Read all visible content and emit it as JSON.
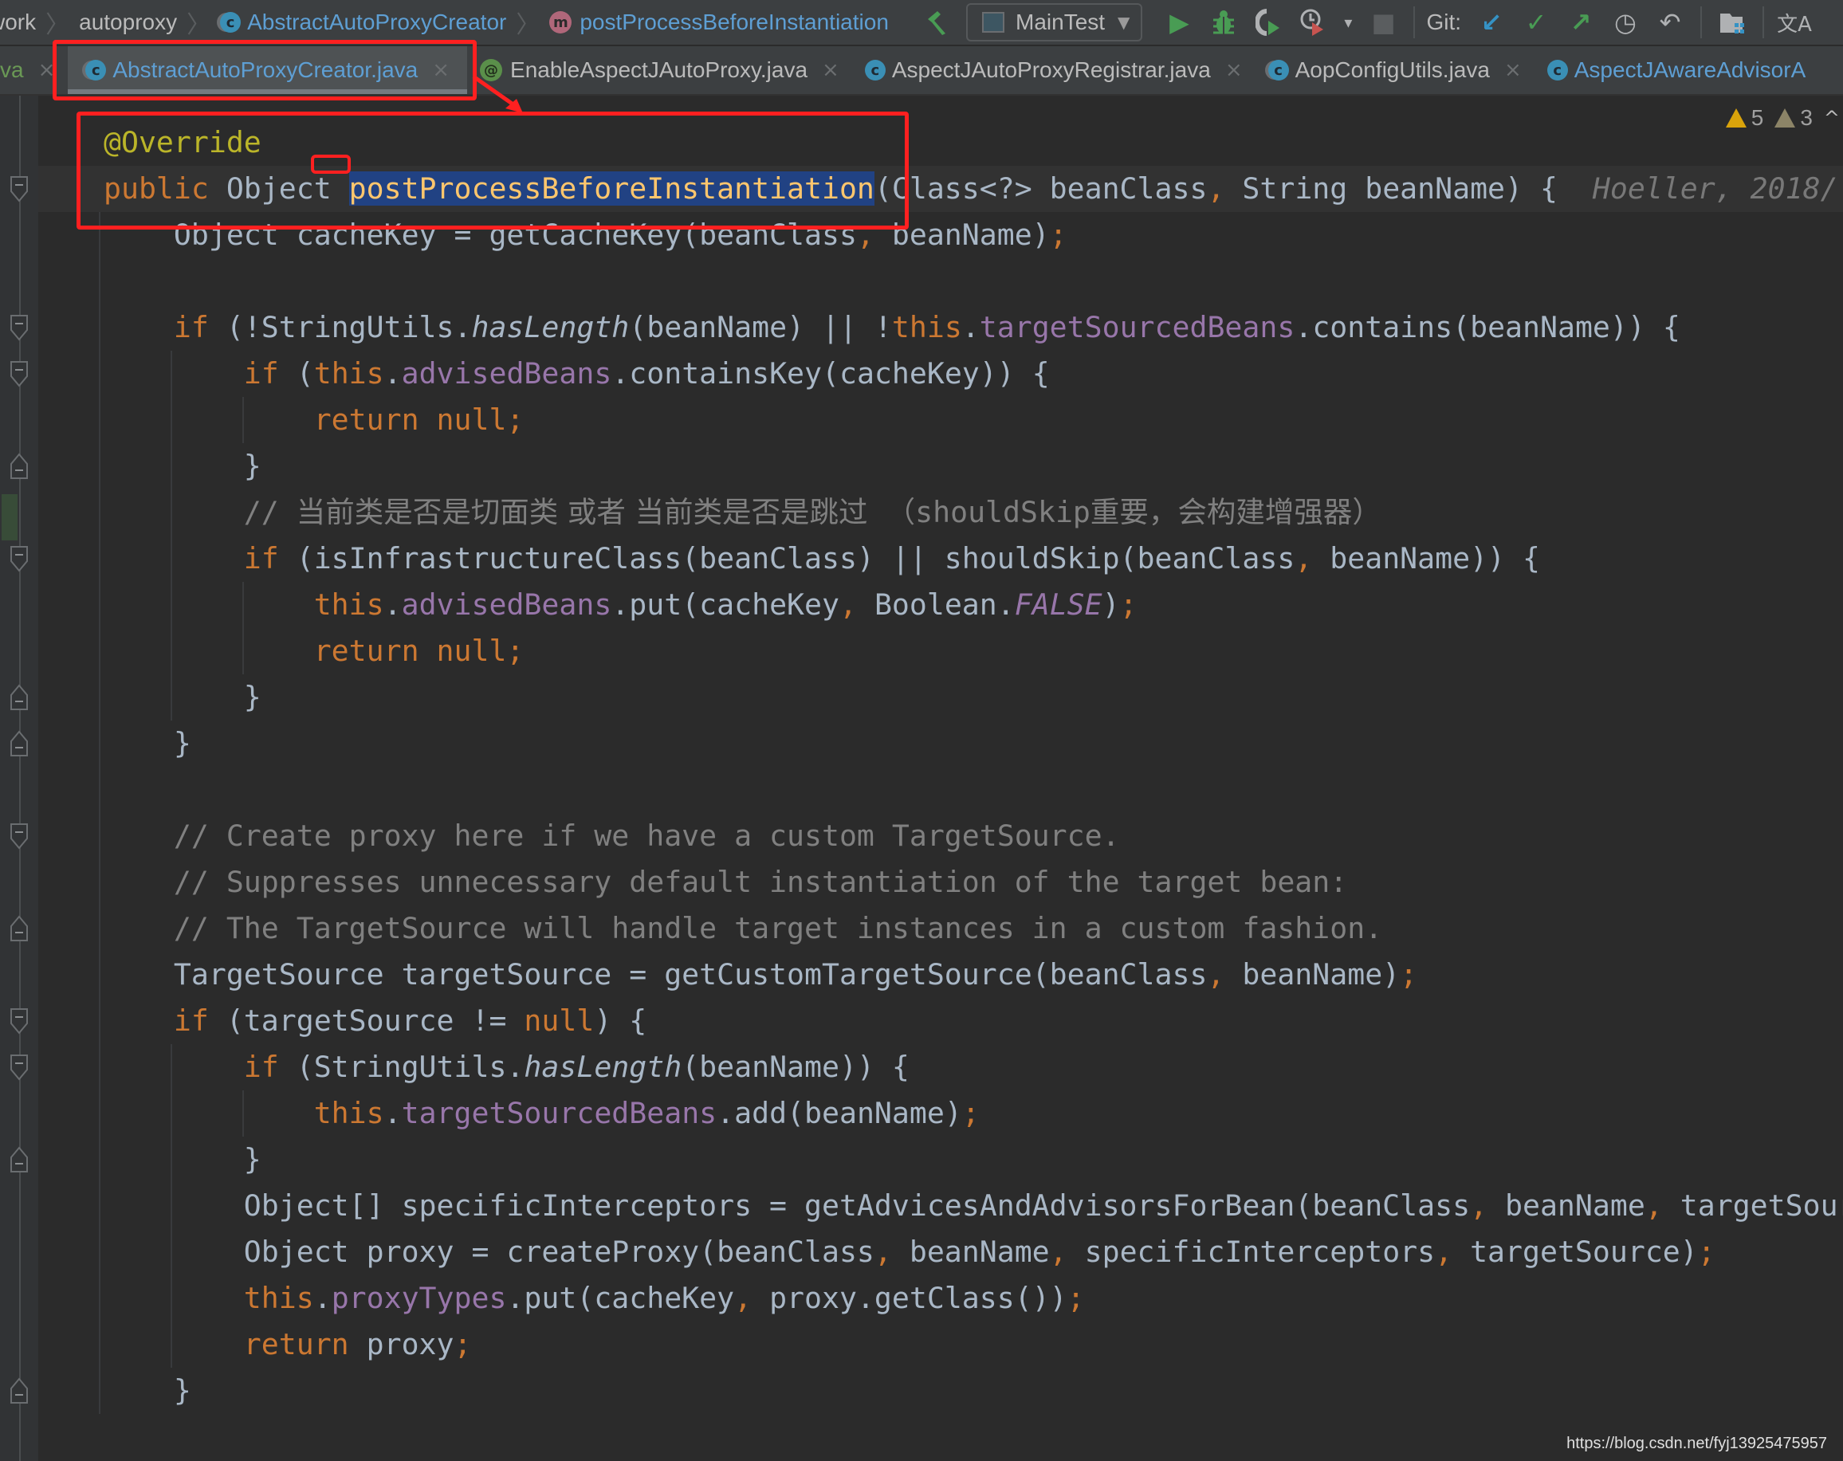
{
  "breadcrumb": {
    "items": [
      {
        "label": "work",
        "icon": null,
        "style": "plain"
      },
      {
        "label": "autoproxy",
        "icon": null,
        "style": "plain"
      },
      {
        "label": "AbstractAutoProxyCreator",
        "icon": "abstract-class-icon",
        "icon_glyph": "c",
        "style": "link"
      },
      {
        "label": "postProcessBeforeInstantiation",
        "icon": "method-icon",
        "icon_glyph": "m",
        "style": "link"
      }
    ],
    "separator": "〉"
  },
  "toolbar": {
    "build_icon": "⬅",
    "run_config": "MainTest",
    "run_config_arrow": "▼",
    "run_icon": "▶",
    "debug_icon": "✱",
    "coverage_icon": "◧",
    "profile_icon": "◔",
    "profile_arrow": "▾",
    "stop_icon": "■",
    "git_label": "Git:",
    "git_update_icon": "↙",
    "git_commit_icon": "✓",
    "git_push_icon": "↗",
    "git_history_icon": "◷",
    "git_rollback_icon": "↶",
    "project_structure_icon": "▙",
    "translate_icon": "文A"
  },
  "tabs": [
    {
      "label": "va",
      "icon": null,
      "active": false,
      "partial": true,
      "close": "×"
    },
    {
      "label": "AbstractAutoProxyCreator.java",
      "icon": "abstract-class-icon",
      "icon_glyph": "c",
      "active": true,
      "close": "×"
    },
    {
      "label": "EnableAspectJAutoProxy.java",
      "icon": "annotation-icon",
      "icon_glyph": "@",
      "active": false,
      "close": "×"
    },
    {
      "label": "AspectJAutoProxyRegistrar.java",
      "icon": "class-icon",
      "icon_glyph": "c",
      "active": false,
      "close": "×"
    },
    {
      "label": "AopConfigUtils.java",
      "icon": "abstract-class-icon",
      "icon_glyph": "c",
      "active": false,
      "close": "×"
    },
    {
      "label": "AspectJAwareAdvisorA",
      "icon": "class-icon",
      "icon_glyph": "c",
      "active": false,
      "close": ""
    }
  ],
  "inspections": {
    "warnings": "5",
    "weak_warnings": "3",
    "nav_up": "^"
  },
  "editor": {
    "blame": "Hoeller, 2018/",
    "lines": [
      [
        [
          "ann",
          "@Override"
        ]
      ],
      [
        [
          "kw",
          "public "
        ],
        [
          "",
          "Object "
        ],
        [
          "fn sel",
          "postProcessBeforeInstantiation"
        ],
        [
          "",
          "(Class<?> beanClass"
        ],
        [
          "punc",
          ", "
        ],
        [
          "",
          "String beanName) {"
        ]
      ],
      [
        [
          "",
          "    Object cacheKey = getCacheKey(beanClass"
        ],
        [
          "punc",
          ", "
        ],
        [
          "",
          "beanName)"
        ],
        [
          "punc",
          ";"
        ]
      ],
      [
        [
          "",
          ""
        ]
      ],
      [
        [
          "kw",
          "    if "
        ],
        [
          "",
          "(!StringUtils."
        ],
        [
          "it",
          "hasLength"
        ],
        [
          "",
          "(beanName) || !"
        ],
        [
          "kw",
          "this"
        ],
        [
          "",
          "."
        ],
        [
          "fld",
          "targetSourcedBeans"
        ],
        [
          "",
          ".contains(beanName)) {"
        ]
      ],
      [
        [
          "kw",
          "        if "
        ],
        [
          "",
          "("
        ],
        [
          "kw",
          "this"
        ],
        [
          "",
          "."
        ],
        [
          "fld",
          "advisedBeans"
        ],
        [
          "",
          ".containsKey(cacheKey)) {"
        ]
      ],
      [
        [
          "kw",
          "            return null;"
        ]
      ],
      [
        [
          "",
          "        }"
        ]
      ],
      [
        [
          "cm",
          "        // "
        ],
        [
          "cmcn",
          "当前类是否是切面类 或者 当前类是否是跳过  （"
        ],
        [
          "cm",
          "shouldSkip"
        ],
        [
          "cmcn",
          "重要，会构建增强器）"
        ]
      ],
      [
        [
          "kw",
          "        if "
        ],
        [
          "",
          "(isInfrastructureClass(beanClass) || shouldSkip(beanClass"
        ],
        [
          "punc",
          ", "
        ],
        [
          "",
          "beanName)) {"
        ]
      ],
      [
        [
          "kw",
          "            this"
        ],
        [
          "",
          "."
        ],
        [
          "fld",
          "advisedBeans"
        ],
        [
          "",
          ".put(cacheKey"
        ],
        [
          "punc",
          ", "
        ],
        [
          "",
          "Boolean."
        ],
        [
          "fld it",
          "FALSE"
        ],
        [
          "",
          ")"
        ],
        [
          "punc",
          ";"
        ]
      ],
      [
        [
          "kw",
          "            return null;"
        ]
      ],
      [
        [
          "",
          "        }"
        ]
      ],
      [
        [
          "",
          "    }"
        ]
      ],
      [
        [
          "",
          ""
        ]
      ],
      [
        [
          "cm",
          "    // Create proxy here if we have a custom TargetSource."
        ]
      ],
      [
        [
          "cm",
          "    // Suppresses unnecessary default instantiation of the target bean:"
        ]
      ],
      [
        [
          "cm",
          "    // The TargetSource will handle target instances in a custom fashion."
        ]
      ],
      [
        [
          "",
          "    TargetSource targetSource = getCustomTargetSource(beanClass"
        ],
        [
          "punc",
          ", "
        ],
        [
          "",
          "beanName)"
        ],
        [
          "punc",
          ";"
        ]
      ],
      [
        [
          "kw",
          "    if "
        ],
        [
          "",
          "(targetSource != "
        ],
        [
          "kw",
          "null"
        ],
        [
          "",
          ") {"
        ]
      ],
      [
        [
          "kw",
          "        if "
        ],
        [
          "",
          "(StringUtils."
        ],
        [
          "it",
          "hasLength"
        ],
        [
          "",
          "(beanName)) {"
        ]
      ],
      [
        [
          "kw",
          "            this"
        ],
        [
          "",
          "."
        ],
        [
          "fld",
          "targetSourcedBeans"
        ],
        [
          "",
          ".add(beanName)"
        ],
        [
          "punc",
          ";"
        ]
      ],
      [
        [
          "",
          "        }"
        ]
      ],
      [
        [
          "",
          "        Object[] specificInterceptors = getAdvicesAndAdvisorsForBean(beanClass"
        ],
        [
          "punc",
          ", "
        ],
        [
          "",
          "beanName"
        ],
        [
          "punc",
          ", "
        ],
        [
          "",
          "targetSource)"
        ],
        [
          "punc",
          ";"
        ]
      ],
      [
        [
          "",
          "        Object proxy = createProxy(beanClass"
        ],
        [
          "punc",
          ", "
        ],
        [
          "",
          "beanName"
        ],
        [
          "punc",
          ", "
        ],
        [
          "",
          "specificInterceptors"
        ],
        [
          "punc",
          ", "
        ],
        [
          "",
          "targetSource)"
        ],
        [
          "punc",
          ";"
        ]
      ],
      [
        [
          "kw",
          "        this"
        ],
        [
          "",
          "."
        ],
        [
          "fld",
          "proxyTypes"
        ],
        [
          "",
          ".put(cacheKey"
        ],
        [
          "punc",
          ", "
        ],
        [
          "",
          "proxy.getClass())"
        ],
        [
          "punc",
          ";"
        ]
      ],
      [
        [
          "kw",
          "        return "
        ],
        [
          "",
          "proxy"
        ],
        [
          "punc",
          ";"
        ]
      ],
      [
        [
          "",
          "    }"
        ]
      ]
    ]
  },
  "watermark": "https://blog.csdn.net/fyj13925475957"
}
